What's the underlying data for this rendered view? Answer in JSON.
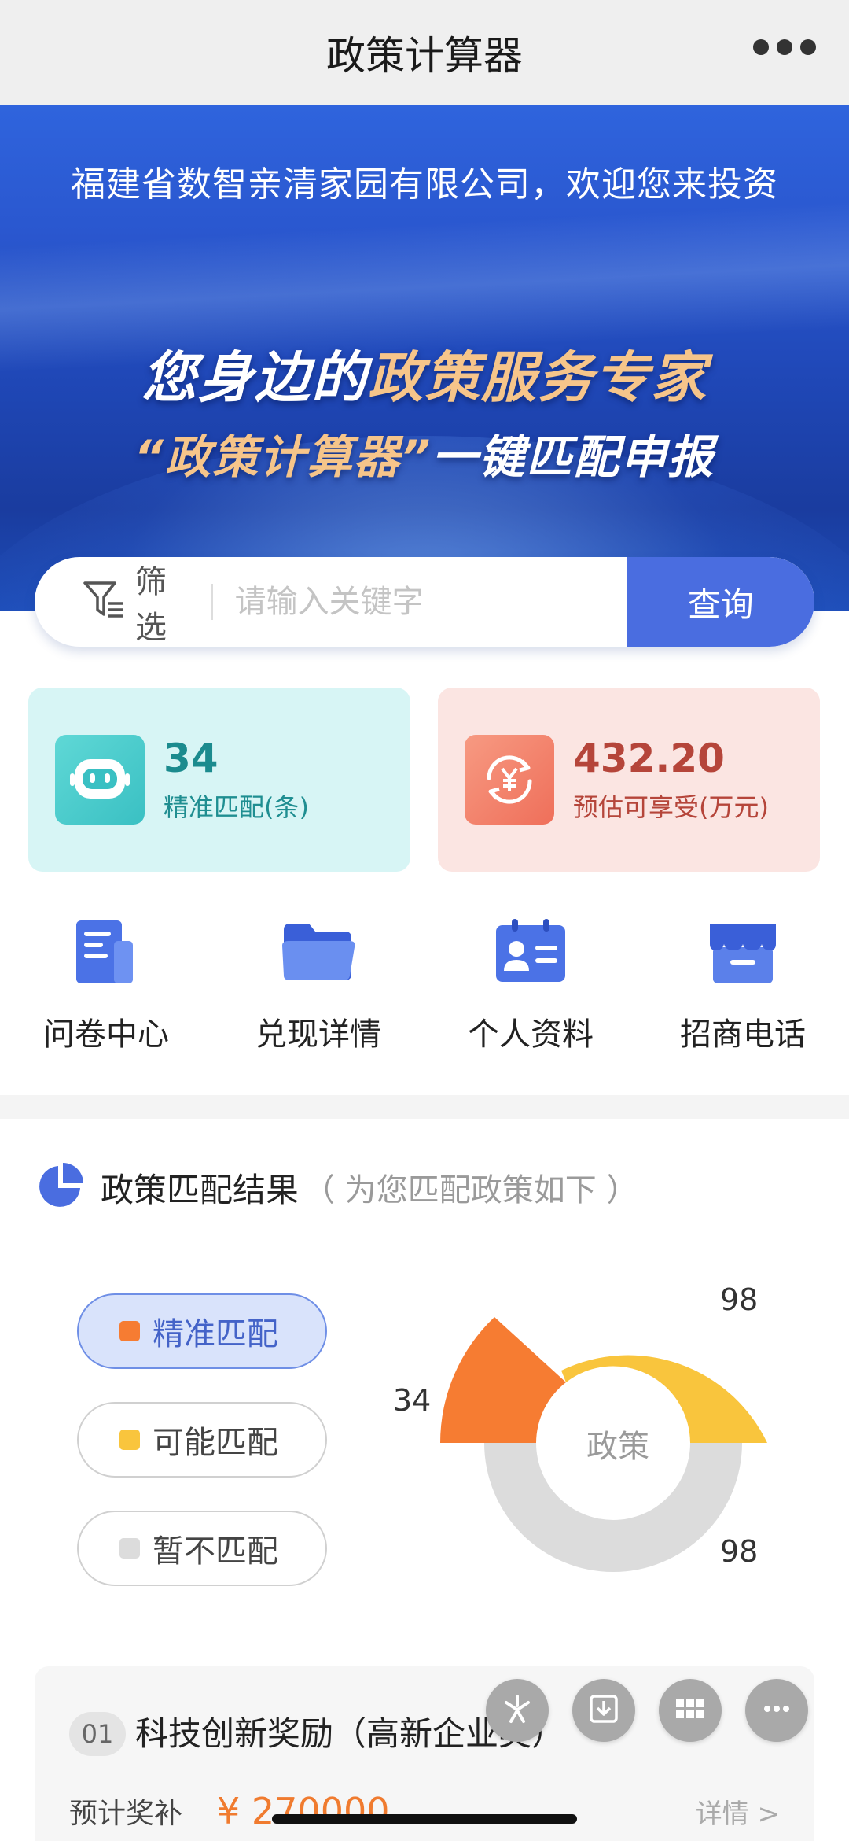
{
  "nav": {
    "title": "政策计算器",
    "more_icon": "more-dots-icon"
  },
  "banner": {
    "company": "福建省数智亲清家园有限公司，欢迎您来投资",
    "slogan1_prefix": "您身边的",
    "slogan1_highlight": "政策服务专家",
    "slogan2_highlight": "“政策计算器”",
    "slogan2_suffix": "一键匹配申报"
  },
  "search": {
    "filter_label": "筛选",
    "placeholder": "请输入关键字",
    "value": "",
    "button": "查询"
  },
  "stats": [
    {
      "value": "34",
      "label": "精准匹配(条)",
      "icon": "robot-icon",
      "color": "#1b8b8e"
    },
    {
      "value": "432.20",
      "label": "预估可享受(万元)",
      "icon": "yuan-refresh-icon",
      "color": "#b5453a"
    }
  ],
  "quick_nav": [
    {
      "label": "问卷中心",
      "icon": "questionnaire-icon"
    },
    {
      "label": "兑现详情",
      "icon": "folder-icon"
    },
    {
      "label": "个人资料",
      "icon": "profile-card-icon"
    },
    {
      "label": "招商电话",
      "icon": "store-icon"
    }
  ],
  "result": {
    "title": "政策匹配结果",
    "subtitle": "（ 为您匹配政策如下 ）",
    "legend": [
      {
        "label": "精准匹配",
        "color": "#f67c32"
      },
      {
        "label": "可能匹配",
        "color": "#f9c53d"
      },
      {
        "label": "暂不匹配",
        "color": "#dcdcdc"
      }
    ],
    "center_label": "政策",
    "values": [
      {
        "name": "精准匹配",
        "value": "34"
      },
      {
        "name": "可能匹配",
        "value": "98"
      },
      {
        "name": "暂不匹配",
        "value": "98"
      }
    ]
  },
  "policy": {
    "no": "01",
    "name": "科技创新奖励（高新企业类）",
    "estimate_label": "预计奖补",
    "amount": "¥ 270000",
    "detail": "详情 >"
  },
  "colors": {
    "accent": "#4a6de0",
    "orange": "#f67c32",
    "yellow": "#f9c53d",
    "grey": "#dcdcdc"
  }
}
